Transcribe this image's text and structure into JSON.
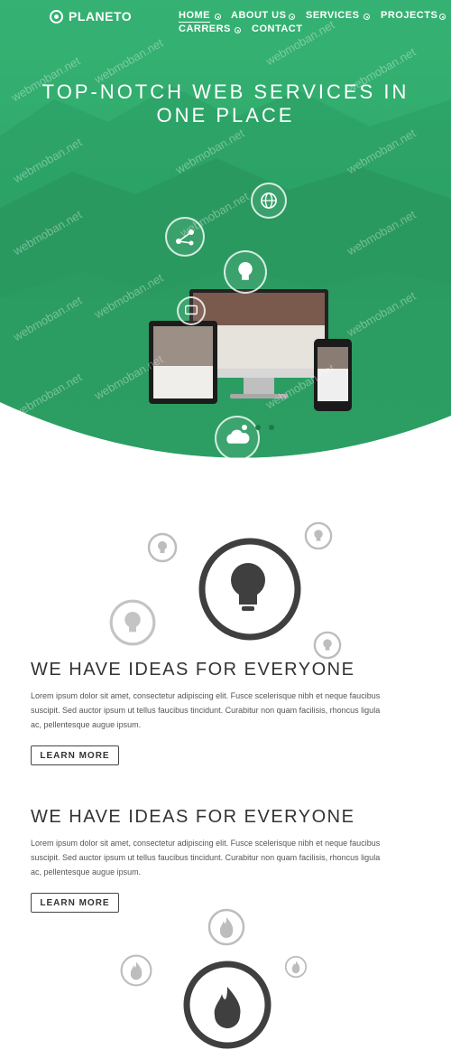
{
  "brand": {
    "name": "PLANETO"
  },
  "nav": {
    "items": [
      {
        "label": "HOME",
        "active": true
      },
      {
        "label": "ABOUT US",
        "active": false
      },
      {
        "label": "SERVICES",
        "active": false
      },
      {
        "label": "PROJECTS",
        "active": false
      },
      {
        "label": "CARRERS",
        "active": false
      },
      {
        "label": "CONTACT",
        "active": false
      }
    ]
  },
  "hero": {
    "title_line1": "TOP-NOTCH WEB SERVICES IN",
    "title_line2": "ONE PLACE",
    "icons": [
      "globe-icon",
      "network-icon",
      "lightbulb-icon",
      "chat-icon",
      "cloud-icon"
    ],
    "slider": {
      "total": 3,
      "active_index": 0
    }
  },
  "watermark": "webmoban.net",
  "sections": [
    {
      "title": "WE HAVE IDEAS FOR EVERYONE",
      "text": "Lorem ipsum dolor sit amet, consectetur adipiscing elit. Fusce scelerisque nibh et neque faucibus suscipit. Sed auctor ipsum ut tellus faucibus tincidunt. Curabitur non quam facilisis, rhoncus ligula ac, pellentesque augue ipsum.",
      "button": "LEARN MORE",
      "icon": "lightbulb-icon"
    },
    {
      "title": "WE HAVE IDEAS FOR EVERYONE",
      "text": "Lorem ipsum dolor sit amet, consectetur adipiscing elit. Fusce scelerisque nibh et neque faucibus suscipit. Sed auctor ipsum ut tellus faucibus tincidunt. Curabitur non quam facilisis, rhoncus ligula ac, pellentesque augue ipsum.",
      "button": "LEARN MORE",
      "icon": "flame-icon"
    }
  ],
  "colors": {
    "hero_green": "#2fa86b",
    "hero_green_light": "#3dbd7e",
    "text_dark": "#333333",
    "text_body": "#555555",
    "icon_gray": "#3f3f3f"
  }
}
